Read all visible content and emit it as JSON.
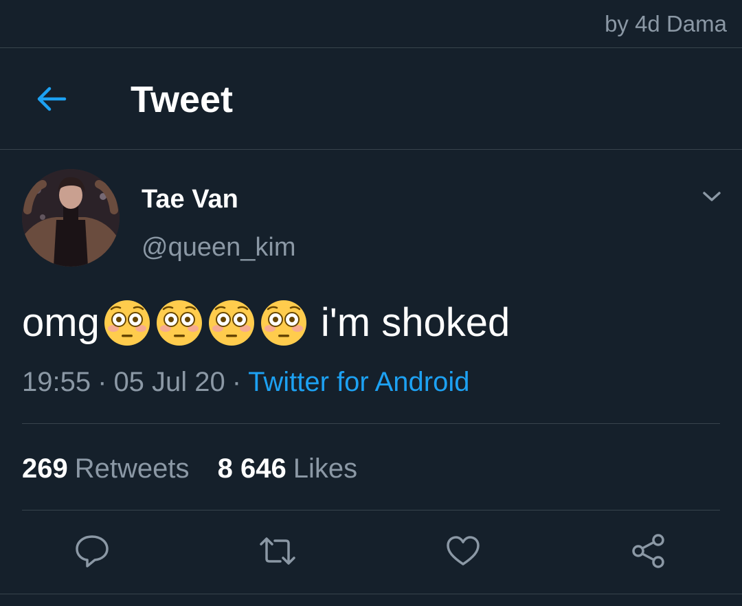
{
  "watermark": "by 4d Dama",
  "header": {
    "title": "Tweet",
    "back_icon": "arrow-left-icon"
  },
  "tweet": {
    "author": {
      "display_name": "Tae Van",
      "handle": "@queen_kim"
    },
    "text_before": "omg",
    "emoji": [
      "😳",
      "😳",
      "😳",
      "😳"
    ],
    "text_after": "i'm shoked",
    "time": "19:55",
    "date": "05 Jul 20",
    "separator": "·",
    "source": "Twitter for Android"
  },
  "stats": {
    "retweets_count": "269",
    "retweets_label": "Retweets",
    "likes_count": "8 646",
    "likes_label": "Likes"
  },
  "actions": [
    "reply-icon",
    "retweet-icon",
    "like-icon",
    "share-icon"
  ],
  "colors": {
    "background": "#15202b",
    "divider": "#38444d",
    "secondary_text": "#8b98a5",
    "accent": "#1da1f2"
  }
}
